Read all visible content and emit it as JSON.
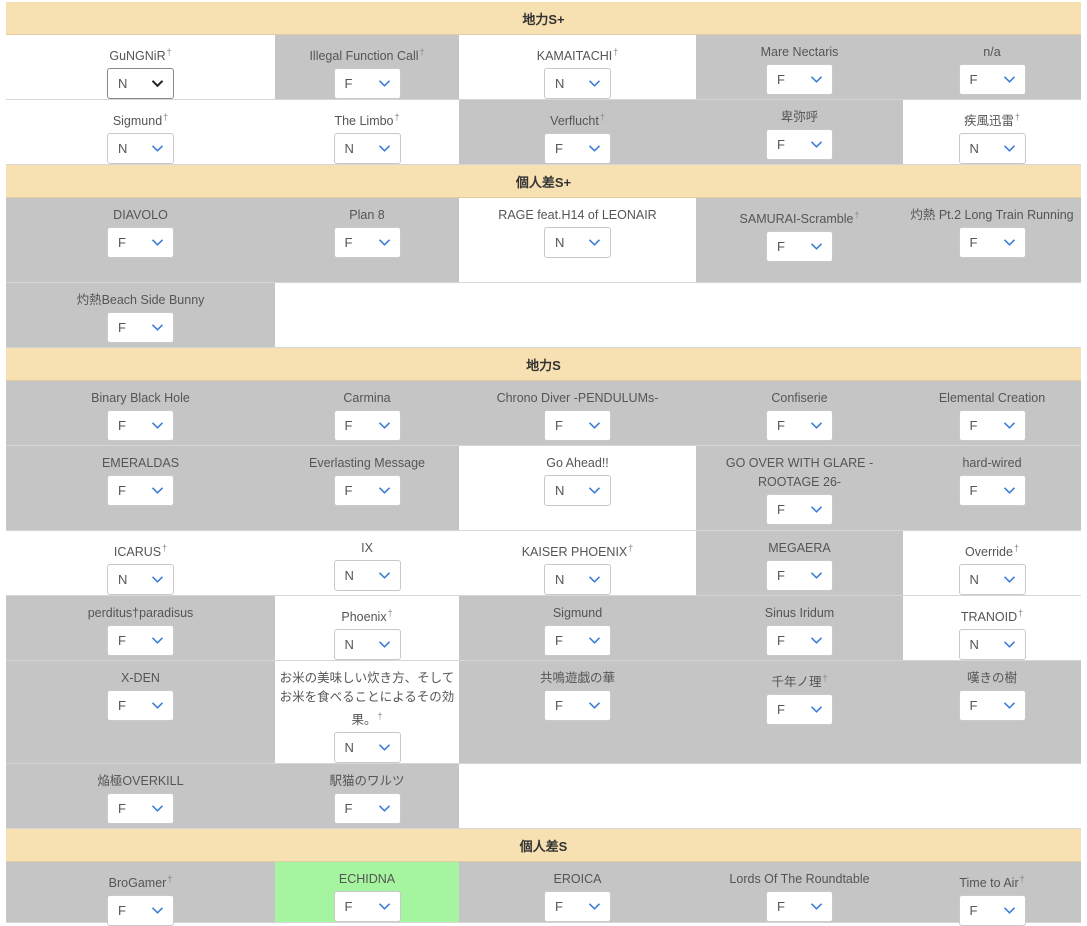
{
  "sections": [
    {
      "header": "地力S+",
      "rows": [
        [
          {
            "title": "GuNGNiR",
            "dagger": true,
            "value": "N",
            "bg": "white",
            "focus": true
          },
          {
            "title": "Illegal Function Call",
            "dagger": true,
            "value": "F",
            "bg": "gray"
          },
          {
            "title": "KAMAITACHI",
            "dagger": true,
            "value": "N",
            "bg": "white"
          },
          {
            "title": "Mare Nectaris",
            "dagger": false,
            "value": "F",
            "bg": "gray"
          },
          {
            "title": "n/a",
            "dagger": false,
            "value": "F",
            "bg": "gray"
          }
        ],
        [
          {
            "title": "Sigmund",
            "dagger": true,
            "value": "N",
            "bg": "white"
          },
          {
            "title": "The Limbo",
            "dagger": true,
            "value": "N",
            "bg": "white"
          },
          {
            "title": "Verflucht",
            "dagger": true,
            "value": "F",
            "bg": "gray"
          },
          {
            "title": "卑弥呼",
            "dagger": false,
            "value": "F",
            "bg": "gray"
          },
          {
            "title": "疾風迅雷",
            "dagger": true,
            "value": "N",
            "bg": "white"
          }
        ]
      ]
    },
    {
      "header": "個人差S+",
      "rows": [
        [
          {
            "title": "DIAVOLO",
            "dagger": false,
            "value": "F",
            "bg": "gray"
          },
          {
            "title": "Plan 8",
            "dagger": false,
            "value": "F",
            "bg": "gray"
          },
          {
            "title": "RAGE feat.H14 of LEONAIR",
            "dagger": false,
            "value": "N",
            "bg": "white"
          },
          {
            "title": "SAMURAI-Scramble",
            "dagger": true,
            "value": "F",
            "bg": "gray"
          },
          {
            "title": "灼熱 Pt.2 Long Train Running",
            "dagger": false,
            "value": "F",
            "bg": "gray"
          }
        ],
        [
          {
            "title": "灼熱Beach Side Bunny",
            "dagger": false,
            "value": "F",
            "bg": "gray"
          }
        ]
      ]
    },
    {
      "header": "地力S",
      "rows": [
        [
          {
            "title": "Binary Black Hole",
            "dagger": false,
            "value": "F",
            "bg": "gray"
          },
          {
            "title": "Carmina",
            "dagger": false,
            "value": "F",
            "bg": "gray"
          },
          {
            "title": "Chrono Diver -PENDULUMs-",
            "dagger": false,
            "value": "F",
            "bg": "gray"
          },
          {
            "title": "Confiserie",
            "dagger": false,
            "value": "F",
            "bg": "gray"
          },
          {
            "title": "Elemental Creation",
            "dagger": false,
            "value": "F",
            "bg": "gray"
          }
        ],
        [
          {
            "title": "EMERALDAS",
            "dagger": false,
            "value": "F",
            "bg": "gray"
          },
          {
            "title": "Everlasting Message",
            "dagger": false,
            "value": "F",
            "bg": "gray"
          },
          {
            "title": "Go Ahead!!",
            "dagger": false,
            "value": "N",
            "bg": "white"
          },
          {
            "title": "GO OVER WITH GLARE -ROOTAGE 26-",
            "dagger": false,
            "value": "F",
            "bg": "gray"
          },
          {
            "title": "hard-wired",
            "dagger": false,
            "value": "F",
            "bg": "gray"
          }
        ],
        [
          {
            "title": "ICARUS",
            "dagger": true,
            "value": "N",
            "bg": "white"
          },
          {
            "title": "IX",
            "dagger": false,
            "value": "N",
            "bg": "white"
          },
          {
            "title": "KAISER PHOENIX",
            "dagger": true,
            "value": "N",
            "bg": "white"
          },
          {
            "title": "MEGAERA",
            "dagger": false,
            "value": "F",
            "bg": "gray"
          },
          {
            "title": "Override",
            "dagger": true,
            "value": "N",
            "bg": "white"
          }
        ],
        [
          {
            "title": "perditus†paradisus",
            "dagger": false,
            "value": "F",
            "bg": "gray"
          },
          {
            "title": "Phoenix",
            "dagger": true,
            "value": "N",
            "bg": "white"
          },
          {
            "title": "Sigmund",
            "dagger": false,
            "value": "F",
            "bg": "gray"
          },
          {
            "title": "Sinus Iridum",
            "dagger": false,
            "value": "F",
            "bg": "gray"
          },
          {
            "title": "TRANOID",
            "dagger": true,
            "value": "N",
            "bg": "white"
          }
        ],
        [
          {
            "title": "X-DEN",
            "dagger": false,
            "value": "F",
            "bg": "gray"
          },
          {
            "title": "お米の美味しい炊き方、そしてお米を食べることによるその効果。",
            "dagger": true,
            "value": "N",
            "bg": "white"
          },
          {
            "title": "共鳴遊戯の華",
            "dagger": false,
            "value": "F",
            "bg": "gray"
          },
          {
            "title": "千年ノ理",
            "dagger": true,
            "value": "F",
            "bg": "gray"
          },
          {
            "title": "嘆きの樹",
            "dagger": false,
            "value": "F",
            "bg": "gray"
          }
        ],
        [
          {
            "title": "焔極OVERKILL",
            "dagger": false,
            "value": "F",
            "bg": "gray"
          },
          {
            "title": "駅猫のワルツ",
            "dagger": false,
            "value": "F",
            "bg": "gray"
          }
        ]
      ]
    },
    {
      "header": "個人差S",
      "rows": [
        [
          {
            "title": "BroGamer",
            "dagger": true,
            "value": "F",
            "bg": "gray"
          },
          {
            "title": "ECHIDNA",
            "dagger": false,
            "value": "F",
            "bg": "green"
          },
          {
            "title": "EROICA",
            "dagger": false,
            "value": "F",
            "bg": "gray"
          },
          {
            "title": "Lords Of The Roundtable",
            "dagger": false,
            "value": "F",
            "bg": "gray"
          },
          {
            "title": "Time to Air",
            "dagger": true,
            "value": "F",
            "bg": "gray"
          }
        ]
      ]
    }
  ],
  "dagger_symbol": "†",
  "colors": {
    "header_bg": "#f7e0b1",
    "gray_cell": "#c5c5c5",
    "white_cell": "#ffffff",
    "green_cell": "#a5f5a0",
    "chevron_blue": "#3b7dd8",
    "chevron_dark": "#222222"
  },
  "icons": {
    "select_arrow": "chevron-down-icon"
  }
}
